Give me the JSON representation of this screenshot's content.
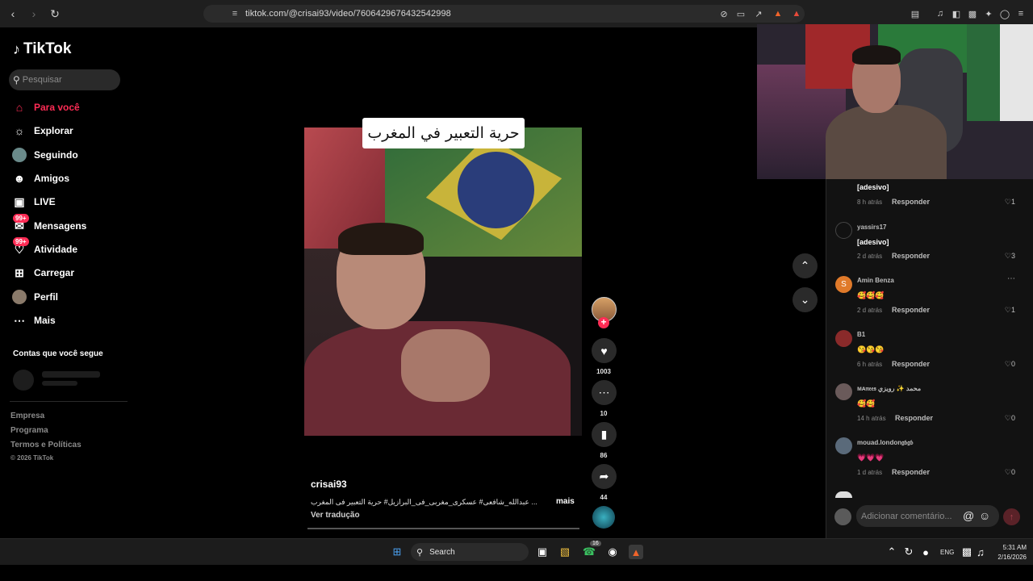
{
  "browser": {
    "url": "tiktok.com/@crisai93/video/7606429676432542998"
  },
  "sidebar": {
    "logo": "TikTok",
    "search_placeholder": "Pesquisar",
    "nav": [
      {
        "label": "Para você",
        "icon": "home-icon",
        "active": true
      },
      {
        "label": "Explorar",
        "icon": "compass-icon"
      },
      {
        "label": "Seguindo",
        "icon": "following-avatar-icon"
      },
      {
        "label": "Amigos",
        "icon": "friends-icon"
      },
      {
        "label": "LIVE",
        "icon": "live-icon"
      },
      {
        "label": "Mensagens",
        "icon": "messages-icon",
        "badge": "99+"
      },
      {
        "label": "Atividade",
        "icon": "activity-icon",
        "badge": "99+"
      },
      {
        "label": "Carregar",
        "icon": "upload-icon"
      },
      {
        "label": "Perfil",
        "icon": "profile-avatar-icon"
      },
      {
        "label": "Mais",
        "icon": "more-icon"
      }
    ],
    "following_title": "Contas que você segue",
    "footer": [
      "Empresa",
      "Programa",
      "Termos e Políticas"
    ],
    "copyright": "© 2026 TikTok"
  },
  "video": {
    "caption_overlay": "حرية التعبير في المغرب",
    "author": "crisai93",
    "description": "... عبدالله_شافعى# عسكرى_مغربى_فى_البرازيل# حرية التعبير فى المغرب",
    "more_label": "mais",
    "translate_label": "Ver tradução"
  },
  "actions": {
    "likes": "1003",
    "comments": "10",
    "saves": "86",
    "shares": "44"
  },
  "comments": {
    "items": [
      {
        "name": "",
        "text": "[adesivo]",
        "time": "8 h atrás",
        "reply": "Responder",
        "likes": "1"
      },
      {
        "name": "yassirs17",
        "text": "[adesivo]",
        "time": "2 d atrás",
        "reply": "Responder",
        "likes": "3"
      },
      {
        "name": "Amin Benza",
        "avatar_letter": "S",
        "text": "🥰🥰🥰",
        "time": "2 d atrás",
        "reply": "Responder",
        "likes": "1"
      },
      {
        "name": "B1",
        "text": "😘😘😘",
        "time": "6 h atrás",
        "reply": "Responder",
        "likes": "0"
      },
      {
        "name": "ᴍᴀ𝔫𝔢𝔢𝔰 محمد ✨ رويزي",
        "text": "🥰🥰",
        "time": "14 h atrás",
        "reply": "Responder",
        "likes": "0"
      },
      {
        "name": "mouad.london𝔤𝔟𝔤𝔟",
        "text": "💗💗💗",
        "time": "1 d atrás",
        "reply": "Responder",
        "likes": "0"
      }
    ],
    "input_placeholder": "Adicionar comentário..."
  },
  "taskbar": {
    "search_label": "Search",
    "whatsapp_badge": "16",
    "lang": "ENG",
    "time": "5:31 AM",
    "date": "2/16/2026"
  },
  "colors": {
    "accent": "#fe2c55",
    "background": "#000000",
    "panel": "#121212"
  }
}
